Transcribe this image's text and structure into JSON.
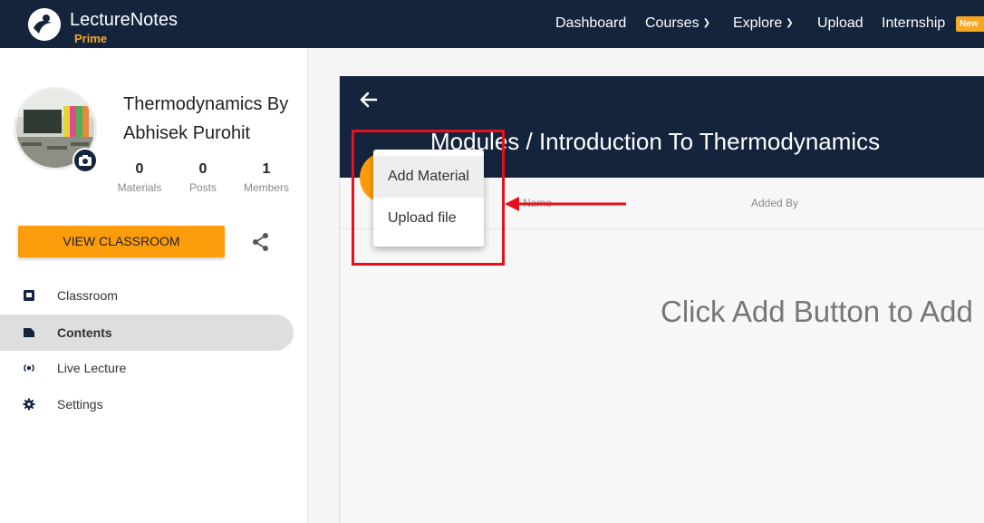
{
  "nav": {
    "brand": "LectureNotes",
    "brand_sub": "Prime",
    "items": [
      "Dashboard",
      "Courses",
      "Explore",
      "Upload",
      "Internship"
    ],
    "new_badge": "New"
  },
  "sidebar": {
    "class_title": "Thermodynamics By Abhisek Purohit",
    "stats": [
      {
        "value": "0",
        "label": "Materials"
      },
      {
        "value": "0",
        "label": "Posts"
      },
      {
        "value": "1",
        "label": "Members"
      }
    ],
    "view_classroom": "VIEW CLASSROOM",
    "menu": [
      {
        "label": "Classroom",
        "icon": "classroom-icon"
      },
      {
        "label": "Contents",
        "icon": "contents-icon"
      },
      {
        "label": "Live Lecture",
        "icon": "live-lecture-icon"
      },
      {
        "label": "Settings",
        "icon": "gear-icon"
      }
    ]
  },
  "main": {
    "title": "Modules / Introduction To Thermodynamics",
    "col_name": "Name",
    "col_added_by": "Added By",
    "empty_message": "Click Add Button to Add"
  },
  "dropdown": {
    "items": [
      "Add Material",
      "Upload file"
    ]
  },
  "colors": {
    "navy": "#14243d",
    "accent": "#fb9c0b",
    "annotation": "#e8101a"
  }
}
